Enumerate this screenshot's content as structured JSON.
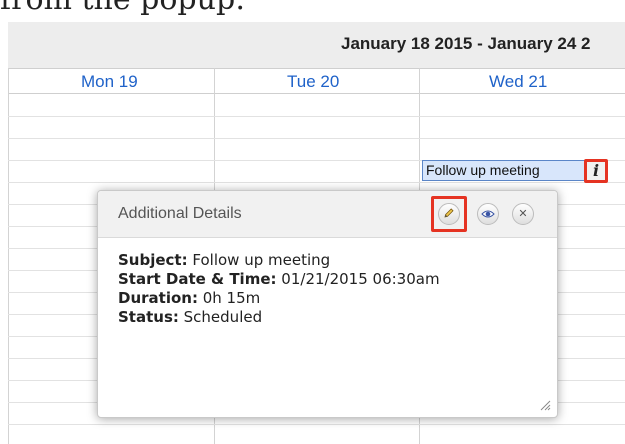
{
  "doc": {
    "heading_fragment": "from the popup:"
  },
  "calendar": {
    "range_title": "January 18 2015 - January 24 2",
    "days": [
      "Mon 19",
      "Tue 20",
      "Wed 21"
    ],
    "event_label": "Follow up meeting",
    "info_glyph": "i"
  },
  "popup": {
    "title": "Additional Details",
    "close_glyph": "✕",
    "fields": [
      {
        "label": "Subject:",
        "value": "Follow up meeting"
      },
      {
        "label": "Start Date & Time:",
        "value": "01/21/2015 06:30am"
      },
      {
        "label": "Duration:",
        "value": "0h 15m"
      },
      {
        "label": "Status:",
        "value": "Scheduled"
      }
    ],
    "icons": [
      "pencil-icon",
      "eye-icon",
      "close-icon",
      "resize-grip-icon"
    ]
  },
  "colors": {
    "highlight": "#e53322",
    "day_link": "#1f62c9",
    "event_fill": "#d8e6fb",
    "event_border": "#5b86c8"
  }
}
